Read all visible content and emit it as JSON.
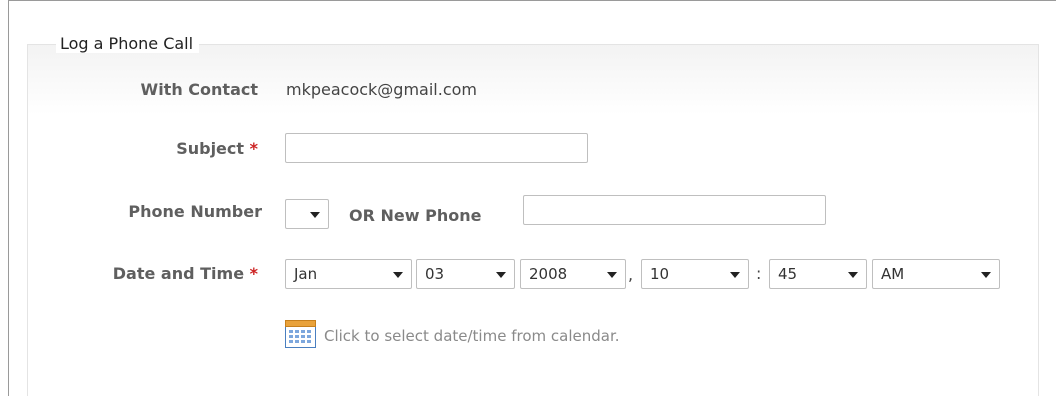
{
  "form": {
    "legend": "Log a Phone Call",
    "required_mark": "*",
    "with_contact": {
      "label": "With Contact",
      "value": "mkpeacock@gmail.com"
    },
    "subject": {
      "label": "Subject",
      "value": ""
    },
    "phone_number": {
      "label": "Phone Number",
      "selected": "",
      "or_label": "OR New Phone",
      "new_phone_value": ""
    },
    "date_time": {
      "label": "Date and Time",
      "month": "Jan",
      "day": "03",
      "year": "2008",
      "comma": ",",
      "hour": "10",
      "colon": ":",
      "minute": "45",
      "ampm": "AM",
      "calendar_link": "Click to select date/time from calendar."
    }
  },
  "colors": {
    "required": "#cc2222",
    "label": "#5f5f5f",
    "border": "#bfbfbf"
  },
  "icons": {
    "calendar": "calendar-icon",
    "dropdown": "chevron-down-icon"
  }
}
